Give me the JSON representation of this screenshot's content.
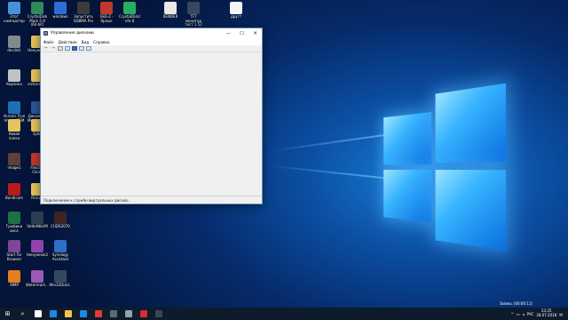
{
  "desktop": {
    "icons": [
      {
        "label": "Этот компьютер",
        "icon": "computer-icon",
        "color": "#4a90d9"
      },
      {
        "label": "CrystalDiskMark 5.8 (64-bit)",
        "icon": "crystaldiskmark-icon",
        "color": "#2e8b57"
      },
      {
        "label": "windows",
        "icon": "folder-icon",
        "color": "#2b6fd6"
      },
      {
        "label": "Запустить SDBMA Pro",
        "icon": "app-icon",
        "color": "#3b3b3b"
      },
      {
        "label": "SSD-Z - Ярлык",
        "icon": "ssdz-icon",
        "color": "#c0392b"
      },
      {
        "label": "CrystalDiskInfo 8",
        "icon": "crystaldiskinfo-icon",
        "color": "#27ae60"
      },
      {
        "label": "RENDER",
        "icon": "file-icon",
        "color": "#e8e8e8"
      },
      {
        "label": "TFT монитор тест 1.52",
        "icon": "monitor-icon",
        "color": "#34495e"
      },
      {
        "label": "другт",
        "icon": "document-icon",
        "color": "#f5f5f5"
      },
      {
        "label": "devilish",
        "icon": "user-icon",
        "color": "#7f8c8d"
      },
      {
        "label": "Ненужное",
        "icon": "folder-icon",
        "color": "#e6c35c"
      },
      {
        "label": "Корзина",
        "icon": "recycle-bin-icon",
        "color": "#bdc3c7"
      },
      {
        "label": "victoria_fix",
        "icon": "folder-icon",
        "color": "#e6c35c"
      },
      {
        "label": "Acronis True Image OEM",
        "icon": "acronis-icon",
        "color": "#1f6fb5"
      },
      {
        "label": "Документ Microsoft...",
        "icon": "word-icon",
        "color": "#2b5797"
      },
      {
        "label": "Новая папка",
        "icon": "folder-icon",
        "color": "#e6c35c"
      },
      {
        "label": "Зубы",
        "icon": "folder-icon",
        "color": "#e6c35c"
      },
      {
        "label": "image1",
        "icon": "image-icon",
        "color": "#5d4037"
      },
      {
        "label": "FileZilla Client",
        "icon": "filezilla-icon",
        "color": "#c0392b"
      },
      {
        "label": "Bandicam",
        "icon": "bandicam-icon",
        "color": "#b71c1c"
      },
      {
        "label": "Picture",
        "icon": "folder-icon",
        "color": "#e6c35c"
      },
      {
        "label": "Графики веса",
        "icon": "excel-icon",
        "color": "#1e7145"
      },
      {
        "label": "StdIntNkUM",
        "icon": "image-icon",
        "color": "#2c3e50"
      },
      {
        "label": "CUDS2070",
        "icon": "image-icon",
        "color": "#3e2723"
      },
      {
        "label": "Start Tor Browser",
        "icon": "tor-icon",
        "color": "#7d4698"
      },
      {
        "label": "Ненужное2",
        "icon": "winrar-icon",
        "color": "#8e44ad"
      },
      {
        "label": "Synology Assistant",
        "icon": "synology-icon",
        "color": "#2f6fc6"
      },
      {
        "label": "AIMP",
        "icon": "aimp-icon",
        "color": "#e67e22"
      },
      {
        "label": "Watermark...",
        "icon": "watermark-icon",
        "color": "#9b59b6"
      },
      {
        "label": "Win32DiskI...",
        "icon": "disk-imager-icon",
        "color": "#34495e"
      }
    ]
  },
  "window": {
    "title": "Управление дисками",
    "minimize": "—",
    "maximize": "☐",
    "close": "✕",
    "menu": [
      "Файл",
      "Действие",
      "Вид",
      "Справка"
    ],
    "status": "Подключение к службе виртуальных дисков..."
  },
  "taskbar": {
    "start": "⊞",
    "search": "⌕",
    "apps": [
      {
        "icon": "task-view-icon",
        "color": "#ffffff"
      },
      {
        "icon": "edge-icon",
        "color": "#1e88e5"
      },
      {
        "icon": "explorer-icon",
        "color": "#f4c542"
      },
      {
        "icon": "store-icon",
        "color": "#1e88e5"
      },
      {
        "icon": "chrome-icon",
        "color": "#e53935"
      },
      {
        "icon": "calculator-icon",
        "color": "#546e7a"
      },
      {
        "icon": "disk-management-icon",
        "color": "#90a4ae"
      },
      {
        "icon": "bandicam-icon",
        "color": "#d32f2f"
      },
      {
        "icon": "video-icon",
        "color": "#37474f"
      }
    ],
    "recording": "Запись [00:00:11]",
    "lang": "РУС",
    "time": "23:25",
    "date": "28.07.2018"
  }
}
